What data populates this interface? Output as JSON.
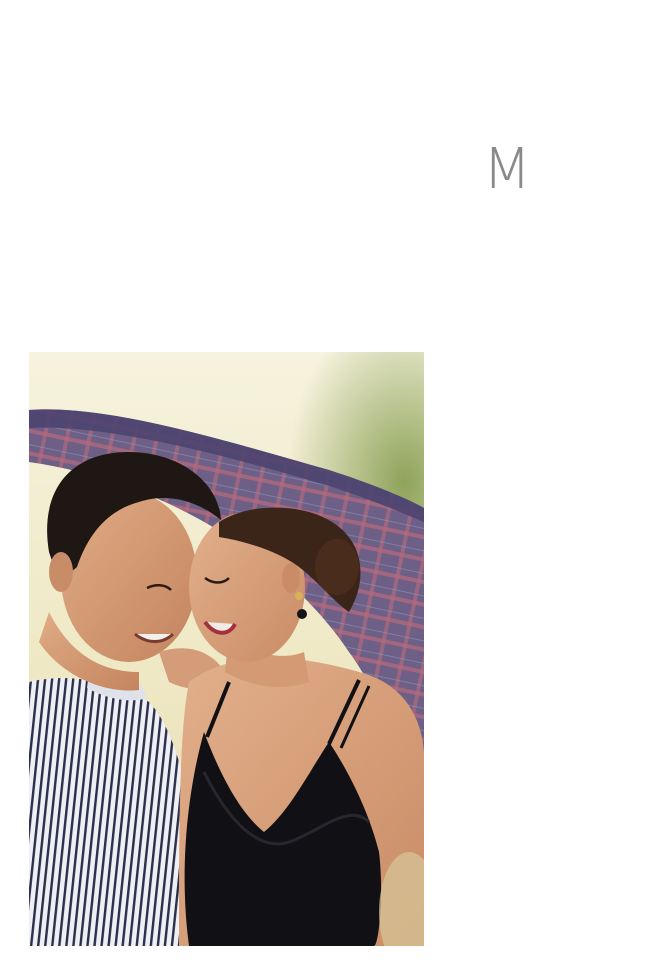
{
  "page": {
    "monogram": "M"
  },
  "photo": {
    "subject": "couple-portrait",
    "colors": {
      "sky": "#f4f1d8",
      "foliage": "#9fb06a",
      "blanket": "#6e5f86",
      "blanket_check": "#c46a78",
      "skin": "#d9a27e",
      "hair": "#2a1e1a",
      "shirt_stripe_dark": "#2c2f4a",
      "shirt_stripe_light": "#eef0f5",
      "dress": "#111014"
    }
  }
}
